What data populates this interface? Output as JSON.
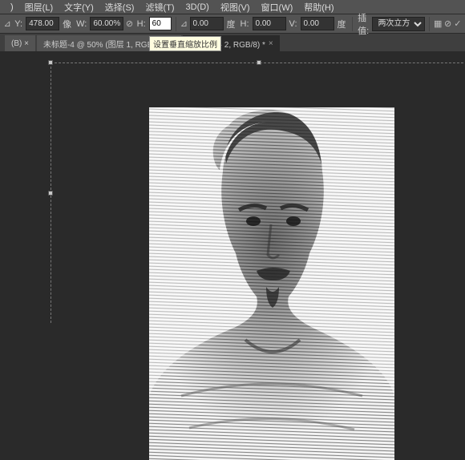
{
  "menu": {
    "items": [
      ")",
      "图层(L)",
      "文字(Y)",
      "选择(S)",
      "滤镜(T)",
      "3D(D)",
      "视图(V)",
      "窗口(W)",
      "帮助(H)"
    ]
  },
  "options": {
    "ref_icon": "⊿",
    "y_label": "Y:",
    "y_value": "478.00",
    "y_unit": "像",
    "w_label": "W:",
    "w_value": "60.00%",
    "link_icon": "⊘",
    "h_label": "H:",
    "h_value": "60",
    "angle_icon": "⊿",
    "angle_value": "0.00",
    "angle_unit": "度",
    "hskew_label": "H:",
    "hskew_value": "0.00",
    "vskew_label": "V:",
    "vskew_value": "0.00",
    "skew_unit": "度",
    "interp_label": "插值:",
    "interp_value": "两次立方",
    "tool_icon": "▦",
    "cancel_icon": "⊘",
    "commit_icon": "✓"
  },
  "tabs": [
    {
      "label": "(B) ×",
      "active": false
    },
    {
      "label": "未标题-4 @ 50% (图层 1, RGB/8) *",
      "active": false,
      "tooltip": "设置垂直缩放比例"
    },
    {
      "label": "7% (图层 2, RGB/8) *",
      "active": true
    }
  ],
  "icons": {
    "close": "×"
  }
}
